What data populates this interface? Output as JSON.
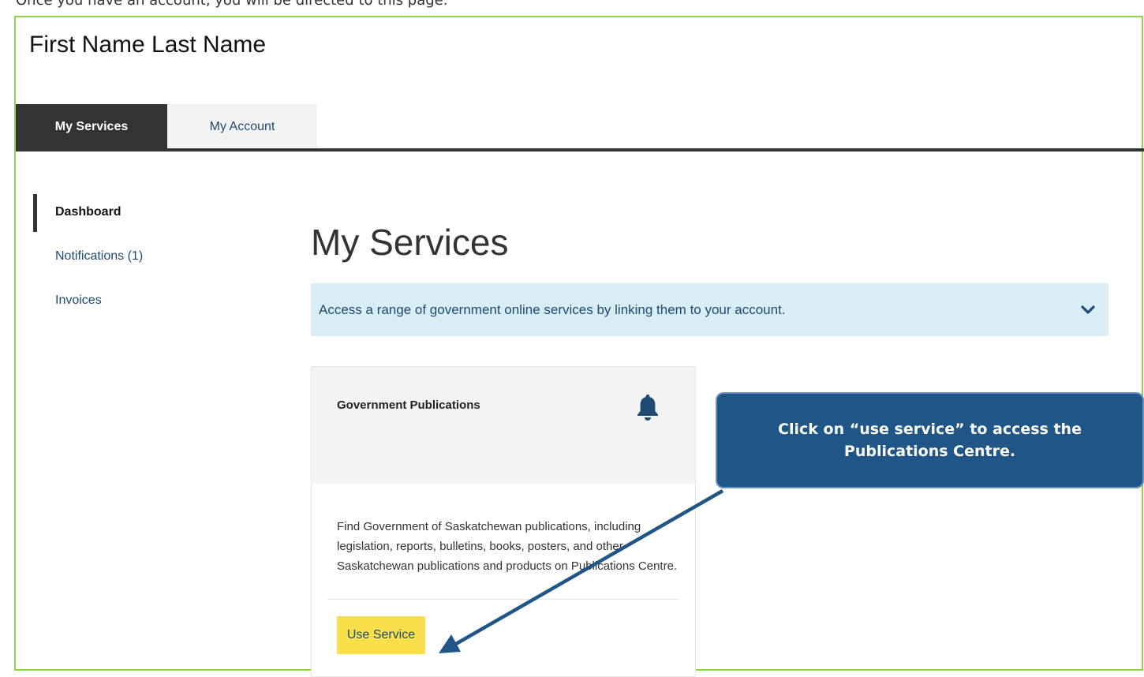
{
  "top_text": "Once you have an account, you will be directed to this page.",
  "user": {
    "name": "First Name Last Name"
  },
  "tabs": [
    {
      "label": "My Services",
      "active": true
    },
    {
      "label": "My Account",
      "active": false
    }
  ],
  "side_nav": {
    "items": [
      {
        "label": "Dashboard",
        "current": true
      },
      {
        "label": "Notifications (1)",
        "current": false
      },
      {
        "label": "Invoices",
        "current": false
      }
    ]
  },
  "main": {
    "title": "My Services",
    "info_bar": {
      "text": "Access a range of government online services by linking them to your account.",
      "icon": "chevron-down-icon"
    }
  },
  "service_card": {
    "title": "Government Publications",
    "icon": "bell-icon",
    "description": "Find Government of Saskatchewan publications, including legislation, reports, bulletins, books, posters, and other Saskatchewan publications and products on Publications Centre.",
    "button_label": "Use Service"
  },
  "annotation": {
    "text": "Click on “use service” to access the Publications Centre."
  },
  "colors": {
    "frame_border": "#92d050",
    "tab_active_bg": "#333333",
    "link": "#1e4a73",
    "info_bar_bg": "#d9edf7",
    "button_bg": "#f9e04a",
    "callout_bg": "#1f5587"
  }
}
